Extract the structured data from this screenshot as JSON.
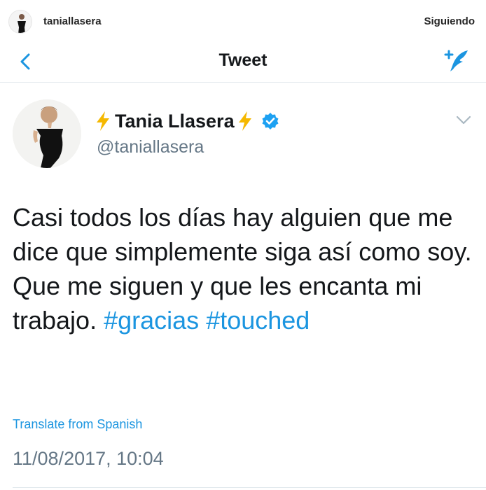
{
  "instagram": {
    "username": "taniallasera",
    "follow_status": "Siguiendo"
  },
  "nav": {
    "title": "Tweet",
    "back_icon": "chevron-left-icon",
    "compose_icon": "compose-tweet-icon"
  },
  "tweet": {
    "display_name": "Tania Llasera",
    "handle": "@taniallasera",
    "verified": true,
    "name_decoration": "lightning-bolt-emoji",
    "text_plain": "Casi todos los días hay alguien que me dice que simplemente siga así como soy. Que me siguen y que les encanta mi trabajo.",
    "hashtags": [
      "#gracias",
      "#touched"
    ],
    "translate_label": "Translate from Spanish",
    "timestamp": "11/08/2017, 10:04"
  },
  "colors": {
    "link_blue": "#1b95e0",
    "text": "#14171a",
    "secondary_text": "#657786",
    "divider": "#e1e8ed",
    "bolt_yellow": "#f5b800"
  }
}
